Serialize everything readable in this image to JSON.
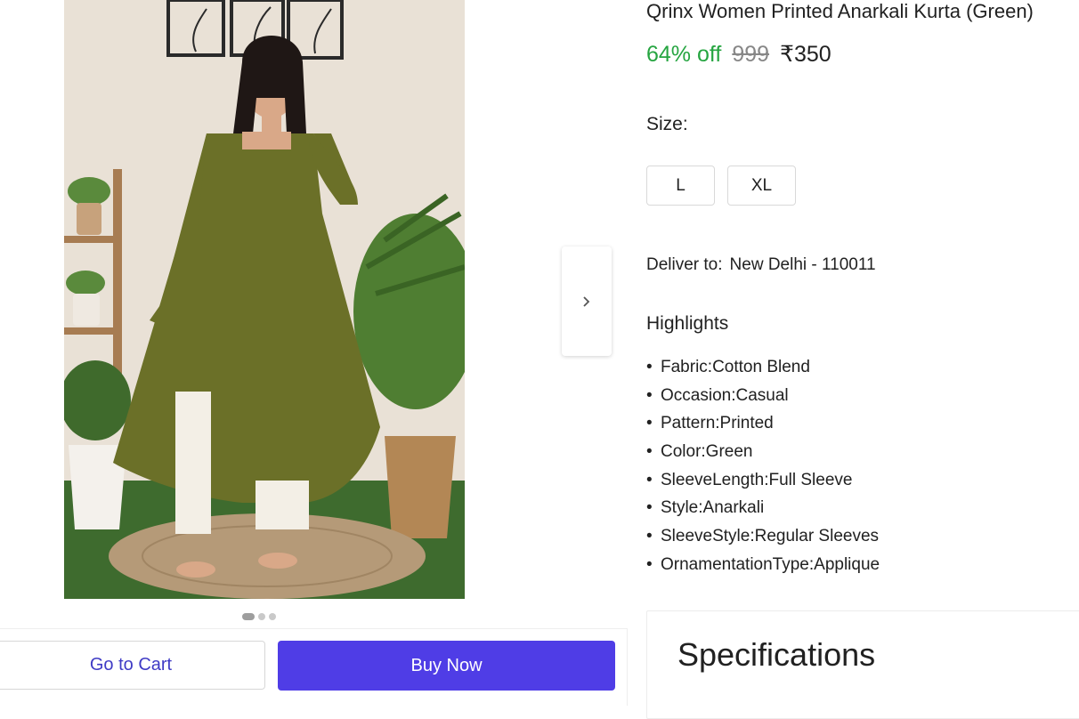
{
  "product": {
    "title": "Qrinx Women Printed Anarkali Kurta (Green)",
    "discount": "64% off",
    "mrp": "999",
    "price": "₹350"
  },
  "size": {
    "label": "Size:",
    "options": [
      "L",
      "XL"
    ]
  },
  "delivery": {
    "label": "Deliver to:",
    "location": "New Delhi - 110011"
  },
  "highlights": {
    "title": "Highlights",
    "items": [
      "Fabric:Cotton Blend",
      "Occasion:Casual",
      "Pattern:Printed",
      "Color:Green",
      "SleeveLength:Full Sleeve",
      "Style:Anarkali",
      "SleeveStyle:Regular Sleeves",
      "OrnamentationType:Applique"
    ]
  },
  "specifications": {
    "title": "Specifications"
  },
  "actions": {
    "cart_label": "Go to Cart",
    "buy_label": "Buy Now"
  },
  "carousel": {
    "total": 3,
    "active": 1
  },
  "icons": {
    "next": "chevron-right-icon"
  },
  "colors": {
    "discount": "#26a541",
    "buy_button": "#4f3de6",
    "cart_text": "#3f3bc5"
  }
}
